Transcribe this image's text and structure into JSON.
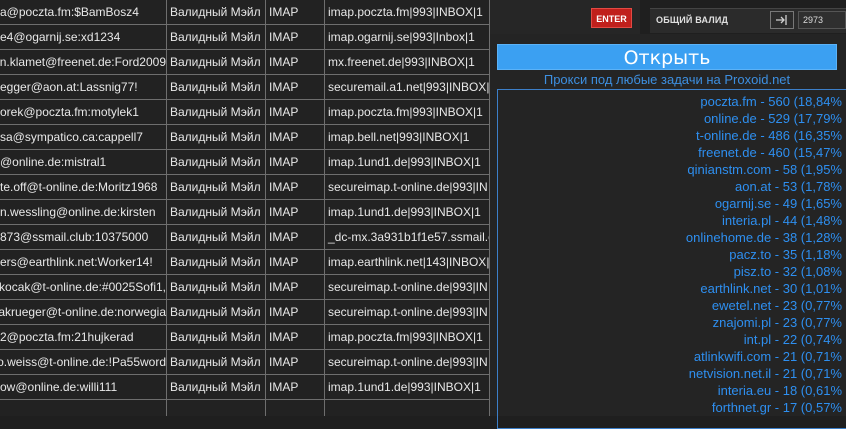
{
  "toolbar": {
    "enter_label": "ENTER",
    "total_label": "ОБЩИЙ ВАЛИД",
    "total_value": "2973"
  },
  "results": {
    "rows": [
      {
        "account": "a@poczta.fm:$BamBosz4",
        "status": "Валидный Мэйл",
        "protocol": "IMAP",
        "server": "imap.poczta.fm|993|INBOX|1"
      },
      {
        "account": "e4@ogarnij.se:xd1234",
        "status": "Валидный Мэйл",
        "protocol": "IMAP",
        "server": "imap.ogarnij.se|993|Inbox|1"
      },
      {
        "account": "n.klamet@freenet.de:Ford2009",
        "status": "Валидный Мэйл",
        "protocol": "IMAP",
        "server": "mx.freenet.de|993|INBOX|1"
      },
      {
        "account": "egger@aon.at:Lassnig77!",
        "status": "Валидный Мэйл",
        "protocol": "IMAP",
        "server": "securemail.a1.net|993|INBOX|1"
      },
      {
        "account": "orek@poczta.fm:motylek1",
        "status": "Валидный Мэйл",
        "protocol": "IMAP",
        "server": "imap.poczta.fm|993|INBOX|1"
      },
      {
        "account": "sa@sympatico.ca:cappell7",
        "status": "Валидный Мэйл",
        "protocol": "IMAP",
        "server": "imap.bell.net|993|INBOX|1"
      },
      {
        "account": "@online.de:mistral1",
        "status": "Валидный Мэйл",
        "protocol": "IMAP",
        "server": "imap.1und1.de|993|INBOX|1"
      },
      {
        "account": "te.off@t-online.de:Moritz1968",
        "status": "Валидный Мэйл",
        "protocol": "IMAP",
        "server": "secureimap.t-online.de|993|IN"
      },
      {
        "account": "n.wessling@online.de:kirsten",
        "status": "Валидный Мэйл",
        "protocol": "IMAP",
        "server": "imap.1und1.de|993|INBOX|1"
      },
      {
        "account": "873@ssmail.club:10375000",
        "status": "Валидный Мэйл",
        "protocol": "IMAP",
        "server": "_dc-mx.3a931b1f1e57.ssmail.c"
      },
      {
        "account": "ers@earthlink.net:Worker14!",
        "status": "Валидный Мэйл",
        "protocol": "IMAP",
        "server": "imap.earthlink.net|143|INBOX|"
      },
      {
        "account": "kocak@t-online.de:#0025Sofi1,",
        "status": "Валидный Мэйл",
        "protocol": "IMAP",
        "server": "secureimap.t-online.de|993|IN"
      },
      {
        "account": "akrueger@t-online.de:norwegia",
        "status": "Валидный Мэйл",
        "protocol": "IMAP",
        "server": "secureimap.t-online.de|993|IN"
      },
      {
        "account": "2@poczta.fm:21hujkerad",
        "status": "Валидный Мэйл",
        "protocol": "IMAP",
        "server": "imap.poczta.fm|993|INBOX|1"
      },
      {
        "account": "o.weiss@t-online.de:!Pa55word",
        "status": "Валидный Мэйл",
        "protocol": "IMAP",
        "server": "secureimap.t-online.de|993|IN"
      },
      {
        "account": "ow@online.de:willi111",
        "status": "Валидный Мэйл",
        "protocol": "IMAP",
        "server": "imap.1und1.de|993|INBOX|1"
      },
      {
        "account": "",
        "status": "",
        "protocol": "",
        "server": ""
      }
    ]
  },
  "panel": {
    "open_label": "Открыть",
    "proxy_text": "Прокси под любые задачи на Proxoid.net",
    "stats": [
      "poczta.fm - 560 (18,84%",
      "online.de - 529 (17,79%",
      "t-online.de - 486 (16,35%",
      "freenet.de - 460 (15,47%",
      "qinianstm.com - 58 (1,95%",
      "aon.at - 53 (1,78%",
      "ogarnij.se - 49 (1,65%",
      "interia.pl - 44 (1,48%",
      "onlinehome.de - 38 (1,28%",
      "pacz.to - 35 (1,18%",
      "pisz.to - 32 (1,08%",
      "earthlink.net - 30 (1,01%",
      "ewetel.net - 23 (0,77%",
      "znajomi.pl - 23 (0,77%",
      "int.pl - 22 (0,74%",
      "atlinkwifi.com - 21 (0,71%",
      "netvision.net.il - 21 (0,71%",
      "interia.eu - 18 (0,61%",
      "forthnet.gr - 17 (0,57%"
    ]
  }
}
